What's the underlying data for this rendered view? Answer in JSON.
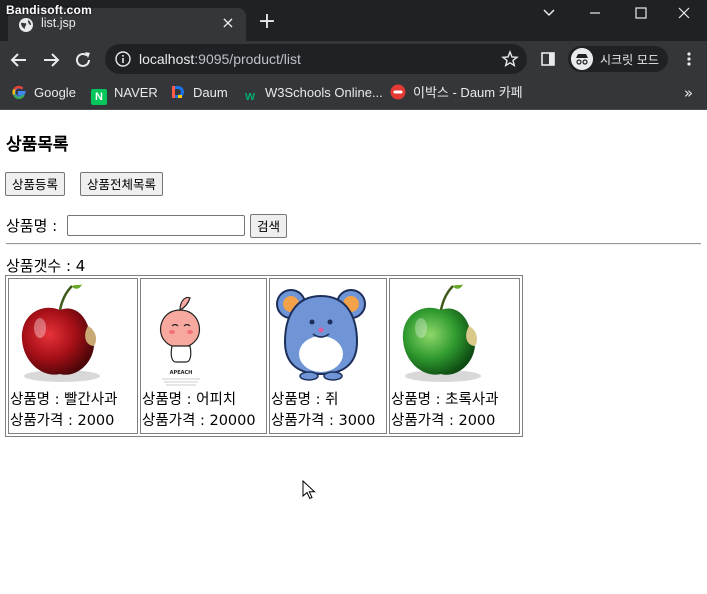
{
  "watermark": "Bandisoft.com",
  "browser": {
    "tab_title": "list.jsp",
    "url_host": "localhost",
    "url_rest": ":9095/product/list",
    "incognito_label": "시크릿 모드",
    "bookmarks": [
      {
        "label": "Google",
        "icon": "google-icon",
        "color": "#4285f4"
      },
      {
        "label": "NAVER",
        "icon": "naver-icon",
        "color": "#03c75a"
      },
      {
        "label": "Daum",
        "icon": "daum-icon",
        "color": "#e8eaed"
      },
      {
        "label": "W3Schools Online...",
        "icon": "w3schools-icon",
        "color": "#04aa6d"
      },
      {
        "label": "이박스 - Daum 카페",
        "icon": "cafe-icon",
        "color": "#e53935"
      }
    ]
  },
  "page": {
    "title": "상품목록",
    "register_button": "상품등록",
    "all_list_button": "상품전체목록",
    "search_label": "상품명 :",
    "search_value": "",
    "search_button": "검색",
    "count_label": "상품갯수 : 4",
    "name_prefix": "상품명 : ",
    "price_prefix": "상품가격 : "
  },
  "products": [
    {
      "name": "빨간사과",
      "price": "2000",
      "image": "red-apple-image",
      "color": "#b3121a"
    },
    {
      "name": "어피치",
      "price": "20000",
      "image": "apeach-image",
      "color": "#f7a9a0"
    },
    {
      "name": "쥐",
      "price": "3000",
      "image": "mouse-image",
      "color": "#6f95d6"
    },
    {
      "name": "초록사과",
      "price": "2000",
      "image": "green-apple-image",
      "color": "#2f9a2f"
    }
  ],
  "apeach_caption": "APEACH"
}
